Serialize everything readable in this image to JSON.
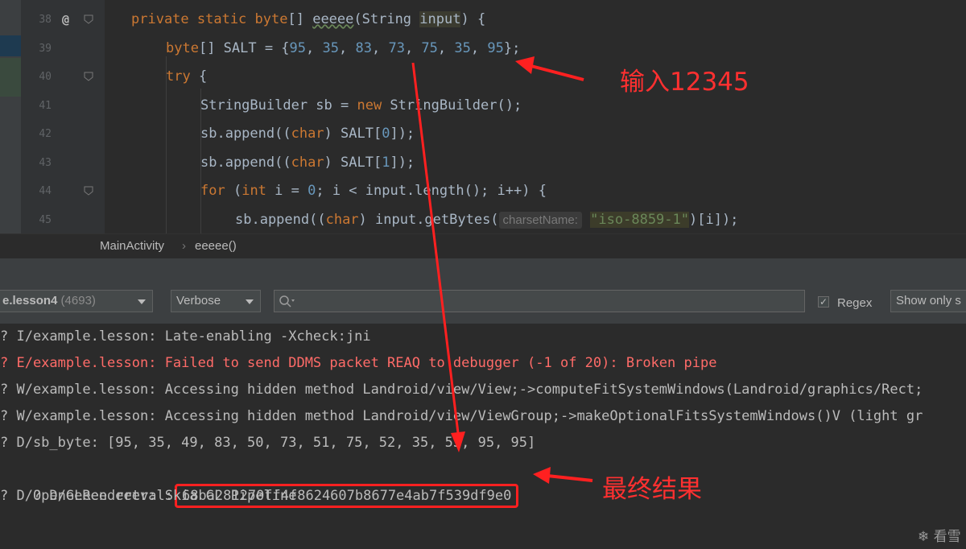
{
  "editor": {
    "lines": [
      {
        "num": "38",
        "segments": [
          {
            "t": "private static ",
            "c": "kw"
          },
          {
            "t": "byte",
            "c": "kw"
          },
          {
            "t": "[] ",
            "c": ""
          },
          {
            "t": "eeeee",
            "c": "squig"
          },
          {
            "t": "(String ",
            "c": ""
          },
          {
            "t": "input",
            "c": "hl"
          },
          {
            "t": ") {",
            "c": ""
          }
        ]
      },
      {
        "num": "39",
        "segments": [
          {
            "t": "byte",
            "c": "kw"
          },
          {
            "t": "[] SALT = {",
            "c": ""
          },
          {
            "t": "95",
            "c": "num"
          },
          {
            "t": ", ",
            "c": ""
          },
          {
            "t": "35",
            "c": "num"
          },
          {
            "t": ", ",
            "c": ""
          },
          {
            "t": "83",
            "c": "num"
          },
          {
            "t": ", ",
            "c": ""
          },
          {
            "t": "73",
            "c": "num"
          },
          {
            "t": ", ",
            "c": ""
          },
          {
            "t": "75",
            "c": "num"
          },
          {
            "t": ", ",
            "c": ""
          },
          {
            "t": "35",
            "c": "num"
          },
          {
            "t": ", ",
            "c": ""
          },
          {
            "t": "95",
            "c": "num"
          },
          {
            "t": "};",
            "c": ""
          }
        ]
      },
      {
        "num": "40",
        "segments": [
          {
            "t": "try",
            "c": "kw"
          },
          {
            "t": " {",
            "c": ""
          }
        ]
      },
      {
        "num": "41",
        "segments": [
          {
            "t": "StringBuilder sb = ",
            "c": ""
          },
          {
            "t": "new",
            "c": "kw"
          },
          {
            "t": " StringBuilder();",
            "c": ""
          }
        ]
      },
      {
        "num": "42",
        "segments": [
          {
            "t": "sb.append((",
            "c": ""
          },
          {
            "t": "char",
            "c": "kw"
          },
          {
            "t": ") SALT[",
            "c": ""
          },
          {
            "t": "0",
            "c": "num"
          },
          {
            "t": "]);",
            "c": ""
          }
        ]
      },
      {
        "num": "43",
        "segments": [
          {
            "t": "sb.append((",
            "c": ""
          },
          {
            "t": "char",
            "c": "kw"
          },
          {
            "t": ") SALT[",
            "c": ""
          },
          {
            "t": "1",
            "c": "num"
          },
          {
            "t": "]);",
            "c": ""
          }
        ]
      },
      {
        "num": "44",
        "segments": [
          {
            "t": "for",
            "c": "kw"
          },
          {
            "t": " (",
            "c": ""
          },
          {
            "t": "int",
            "c": "kw"
          },
          {
            "t": " i = ",
            "c": ""
          },
          {
            "t": "0",
            "c": "num"
          },
          {
            "t": "; i < input.length(); i++) {",
            "c": ""
          }
        ]
      },
      {
        "num": "45",
        "segments": [
          {
            "t": "sb.append((",
            "c": ""
          },
          {
            "t": "char",
            "c": "kw"
          },
          {
            "t": ") input.getBytes(",
            "c": ""
          },
          {
            "t": "charsetName:",
            "c": "hint"
          },
          {
            "t": "\"iso-8859-1\"",
            "c": "strbox"
          },
          {
            "t": ")[i]);",
            "c": ""
          }
        ]
      }
    ],
    "annotation_symbol": "@"
  },
  "breadcrumb": {
    "class_name": "MainActivity",
    "separator": "›",
    "method_name": "eeeee()"
  },
  "logcat_toolbar": {
    "process_name": "e.lesson4",
    "process_pid": "(4693)",
    "log_level": "Verbose",
    "search_placeholder": "",
    "regex_label": "Regex",
    "show_only_label": "Show only s"
  },
  "log": {
    "lines": [
      {
        "text": "? I/example.lesson: Late-enabling -Xcheck:jni",
        "level": "info"
      },
      {
        "text": "? E/example.lesson: Failed to send DDMS packet REAQ to debugger (-1 of 20): Broken pipe",
        "level": "error"
      },
      {
        "text": "? W/example.lesson: Accessing hidden method Landroid/view/View;->computeFitSystemWindows(Landroid/graphics/Rect;",
        "level": "warn"
      },
      {
        "text": "? W/example.lesson: Accessing hidden method Landroid/view/ViewGroup;->makeOptionalFitsSystemWindows()V (light gr",
        "level": "warn"
      },
      {
        "text": "? D/sb_byte: [95, 35, 49, 83, 50, 73, 51, 75, 52, 35, 53, 95, 95]",
        "level": "debug"
      },
      {
        "text": "? D/OpenGLRenderer: Skia GL Pipeline",
        "level": "debug"
      }
    ],
    "retval_prefix": "? D/eeeee retval:",
    "retval_value": "68ba281270ff4f8624607b8677e4ab7f539df9e0"
  },
  "annotations": {
    "input_note": "输入12345",
    "result_note": "最终结果"
  },
  "watermark": "看雪",
  "colors": {
    "arrow": "#ff2020",
    "keyword": "#cc7832",
    "number": "#6897bb",
    "string": "#6a8759",
    "error": "#ff6b68"
  }
}
